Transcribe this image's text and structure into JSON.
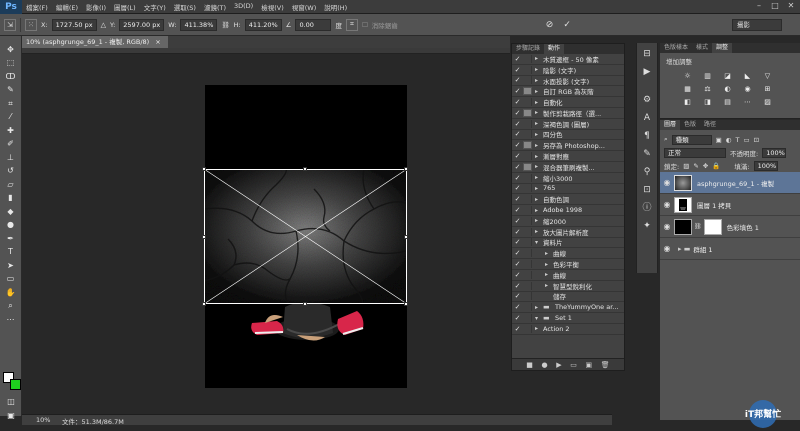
{
  "app": {
    "logo": "Ps"
  },
  "menu": [
    "檔案(F)",
    "編輯(E)",
    "影像(I)",
    "圖層(L)",
    "文字(Y)",
    "選取(S)",
    "濾鏡(T)",
    "3D(D)",
    "檢視(V)",
    "視窗(W)",
    "說明(H)"
  ],
  "window_controls": [
    "–",
    "□",
    "✕"
  ],
  "options": {
    "x_label": "X:",
    "x_value": "1727.50 px",
    "y_label": "Y:",
    "y_value": "2597.00 px",
    "w_label": "W:",
    "w_value": "411.38%",
    "h_label": "H:",
    "h_value": "411.20%",
    "angle_value": "0.00",
    "unit_deg": "度",
    "antialias_label": "消除鋸齒",
    "workspace": "攝影"
  },
  "document": {
    "tab_title": "10% (asphgrunge_69_1 - 複製, RGB/8)",
    "tab_close": "×",
    "zoom": "10%",
    "file_status": "文件：51.3M/86.7M"
  },
  "actions_panel": {
    "tabs": [
      "步驟記錄",
      "動作"
    ],
    "active_tab": "動作",
    "rows": [
      {
        "check": "✓",
        "dialog": false,
        "arrow": "▸",
        "folder": false,
        "indent": 0,
        "label": "木質邊框 - 50 像素"
      },
      {
        "check": "✓",
        "dialog": false,
        "arrow": "▸",
        "folder": false,
        "indent": 0,
        "label": "陰影 (文字)"
      },
      {
        "check": "✓",
        "dialog": false,
        "arrow": "▸",
        "folder": false,
        "indent": 0,
        "label": "水面投影 (文字)"
      },
      {
        "check": "✓",
        "dialog": true,
        "arrow": "▸",
        "folder": false,
        "indent": 0,
        "label": "自訂 RGB 為灰階"
      },
      {
        "check": "✓",
        "dialog": false,
        "arrow": "▸",
        "folder": false,
        "indent": 0,
        "label": "自動化"
      },
      {
        "check": "✓",
        "dialog": true,
        "arrow": "▸",
        "folder": false,
        "indent": 0,
        "label": "製作剪栽路徑（選..."
      },
      {
        "check": "✓",
        "dialog": false,
        "arrow": "▸",
        "folder": false,
        "indent": 0,
        "label": "深褐色調 (圖層)"
      },
      {
        "check": "✓",
        "dialog": false,
        "arrow": "▸",
        "folder": false,
        "indent": 0,
        "label": "四分色"
      },
      {
        "check": "✓",
        "dialog": true,
        "arrow": "▸",
        "folder": false,
        "indent": 0,
        "label": "另存為 Photoshop..."
      },
      {
        "check": "✓",
        "dialog": false,
        "arrow": "▸",
        "folder": false,
        "indent": 0,
        "label": "漸層對應"
      },
      {
        "check": "✓",
        "dialog": true,
        "arrow": "▸",
        "folder": false,
        "indent": 0,
        "label": "混合器筆刷複製..."
      },
      {
        "check": "✓",
        "dialog": false,
        "arrow": "▸",
        "folder": false,
        "indent": 0,
        "label": "縮小3000"
      },
      {
        "check": "✓",
        "dialog": false,
        "arrow": "▸",
        "folder": false,
        "indent": 0,
        "label": "765"
      },
      {
        "check": "✓",
        "dialog": false,
        "arrow": "▸",
        "folder": false,
        "indent": 0,
        "label": "自動色調"
      },
      {
        "check": "✓",
        "dialog": false,
        "arrow": "▸",
        "folder": false,
        "indent": 0,
        "label": "Adobe 1998"
      },
      {
        "check": "✓",
        "dialog": false,
        "arrow": "▸",
        "folder": false,
        "indent": 0,
        "label": "縮2000"
      },
      {
        "check": "✓",
        "dialog": false,
        "arrow": "▸",
        "folder": false,
        "indent": 0,
        "label": "放大圖片解析度"
      },
      {
        "check": "✓",
        "dialog": false,
        "arrow": "▾",
        "folder": false,
        "indent": 0,
        "label": "資料片"
      },
      {
        "check": "✓",
        "dialog": false,
        "arrow": "▸",
        "folder": false,
        "indent": 1,
        "label": "曲線"
      },
      {
        "check": "✓",
        "dialog": false,
        "arrow": "▸",
        "folder": false,
        "indent": 1,
        "label": "色彩平衡"
      },
      {
        "check": "✓",
        "dialog": false,
        "arrow": "▸",
        "folder": false,
        "indent": 1,
        "label": "曲線"
      },
      {
        "check": "✓",
        "dialog": false,
        "arrow": "▸",
        "folder": false,
        "indent": 1,
        "label": "智慧型銳利化"
      },
      {
        "check": "✓",
        "dialog": false,
        "arrow": "",
        "folder": false,
        "indent": 1,
        "label": "儲存"
      },
      {
        "check": "✓",
        "dialog": false,
        "arrow": "▸",
        "folder": true,
        "indent": 0,
        "label": "TheYummyOne ar..."
      },
      {
        "check": "✓",
        "dialog": false,
        "arrow": "▾",
        "folder": true,
        "indent": 0,
        "label": "Set 1"
      },
      {
        "check": "✓",
        "dialog": false,
        "arrow": "▸",
        "folder": false,
        "indent": 0,
        "label": "Action 2"
      }
    ],
    "footer_icons": [
      "■",
      "●",
      "▶",
      "▭",
      "▣",
      "🗑"
    ]
  },
  "adjust_panel": {
    "tabs": [
      "色版樣本",
      "樣式",
      "調整"
    ],
    "active_tab": "調整",
    "title": "增加調整",
    "icons_row1": [
      "☼",
      "▥",
      "◪",
      "◣",
      "▽",
      ""
    ],
    "icons_row2": [
      "▦",
      "⚖",
      "◐",
      "◉",
      "⊞",
      ""
    ],
    "icons_row3": [
      "◧",
      "◨",
      "▤",
      "⋯",
      "▨",
      ""
    ]
  },
  "layers_panel": {
    "tabs": [
      "圖層",
      "色版",
      "路徑"
    ],
    "active_tab": "圖層",
    "filter": "種類",
    "blend_mode": "正常",
    "opacity_label": "不透明度:",
    "opacity_value": "100%",
    "lock_label": "鎖定:",
    "fill_label": "填滿:",
    "fill_value": "100%",
    "layers": [
      {
        "name": "asphgrunge_69_1 - 複製",
        "selected": true,
        "visible": true,
        "thumb": "texture"
      },
      {
        "name": "圖層 1 拷貝",
        "selected": false,
        "visible": true,
        "thumb": "figure"
      },
      {
        "name": "色彩填色 1",
        "selected": false,
        "visible": true,
        "thumb": "fill"
      },
      {
        "name": "群組 1",
        "selected": false,
        "visible": true,
        "thumb": "group"
      }
    ]
  },
  "watermark": {
    "text": "iT邦幫忙"
  },
  "colors": {
    "foreground": "#ffffff",
    "background": "#1ed11e",
    "selection": "#5d7597"
  }
}
